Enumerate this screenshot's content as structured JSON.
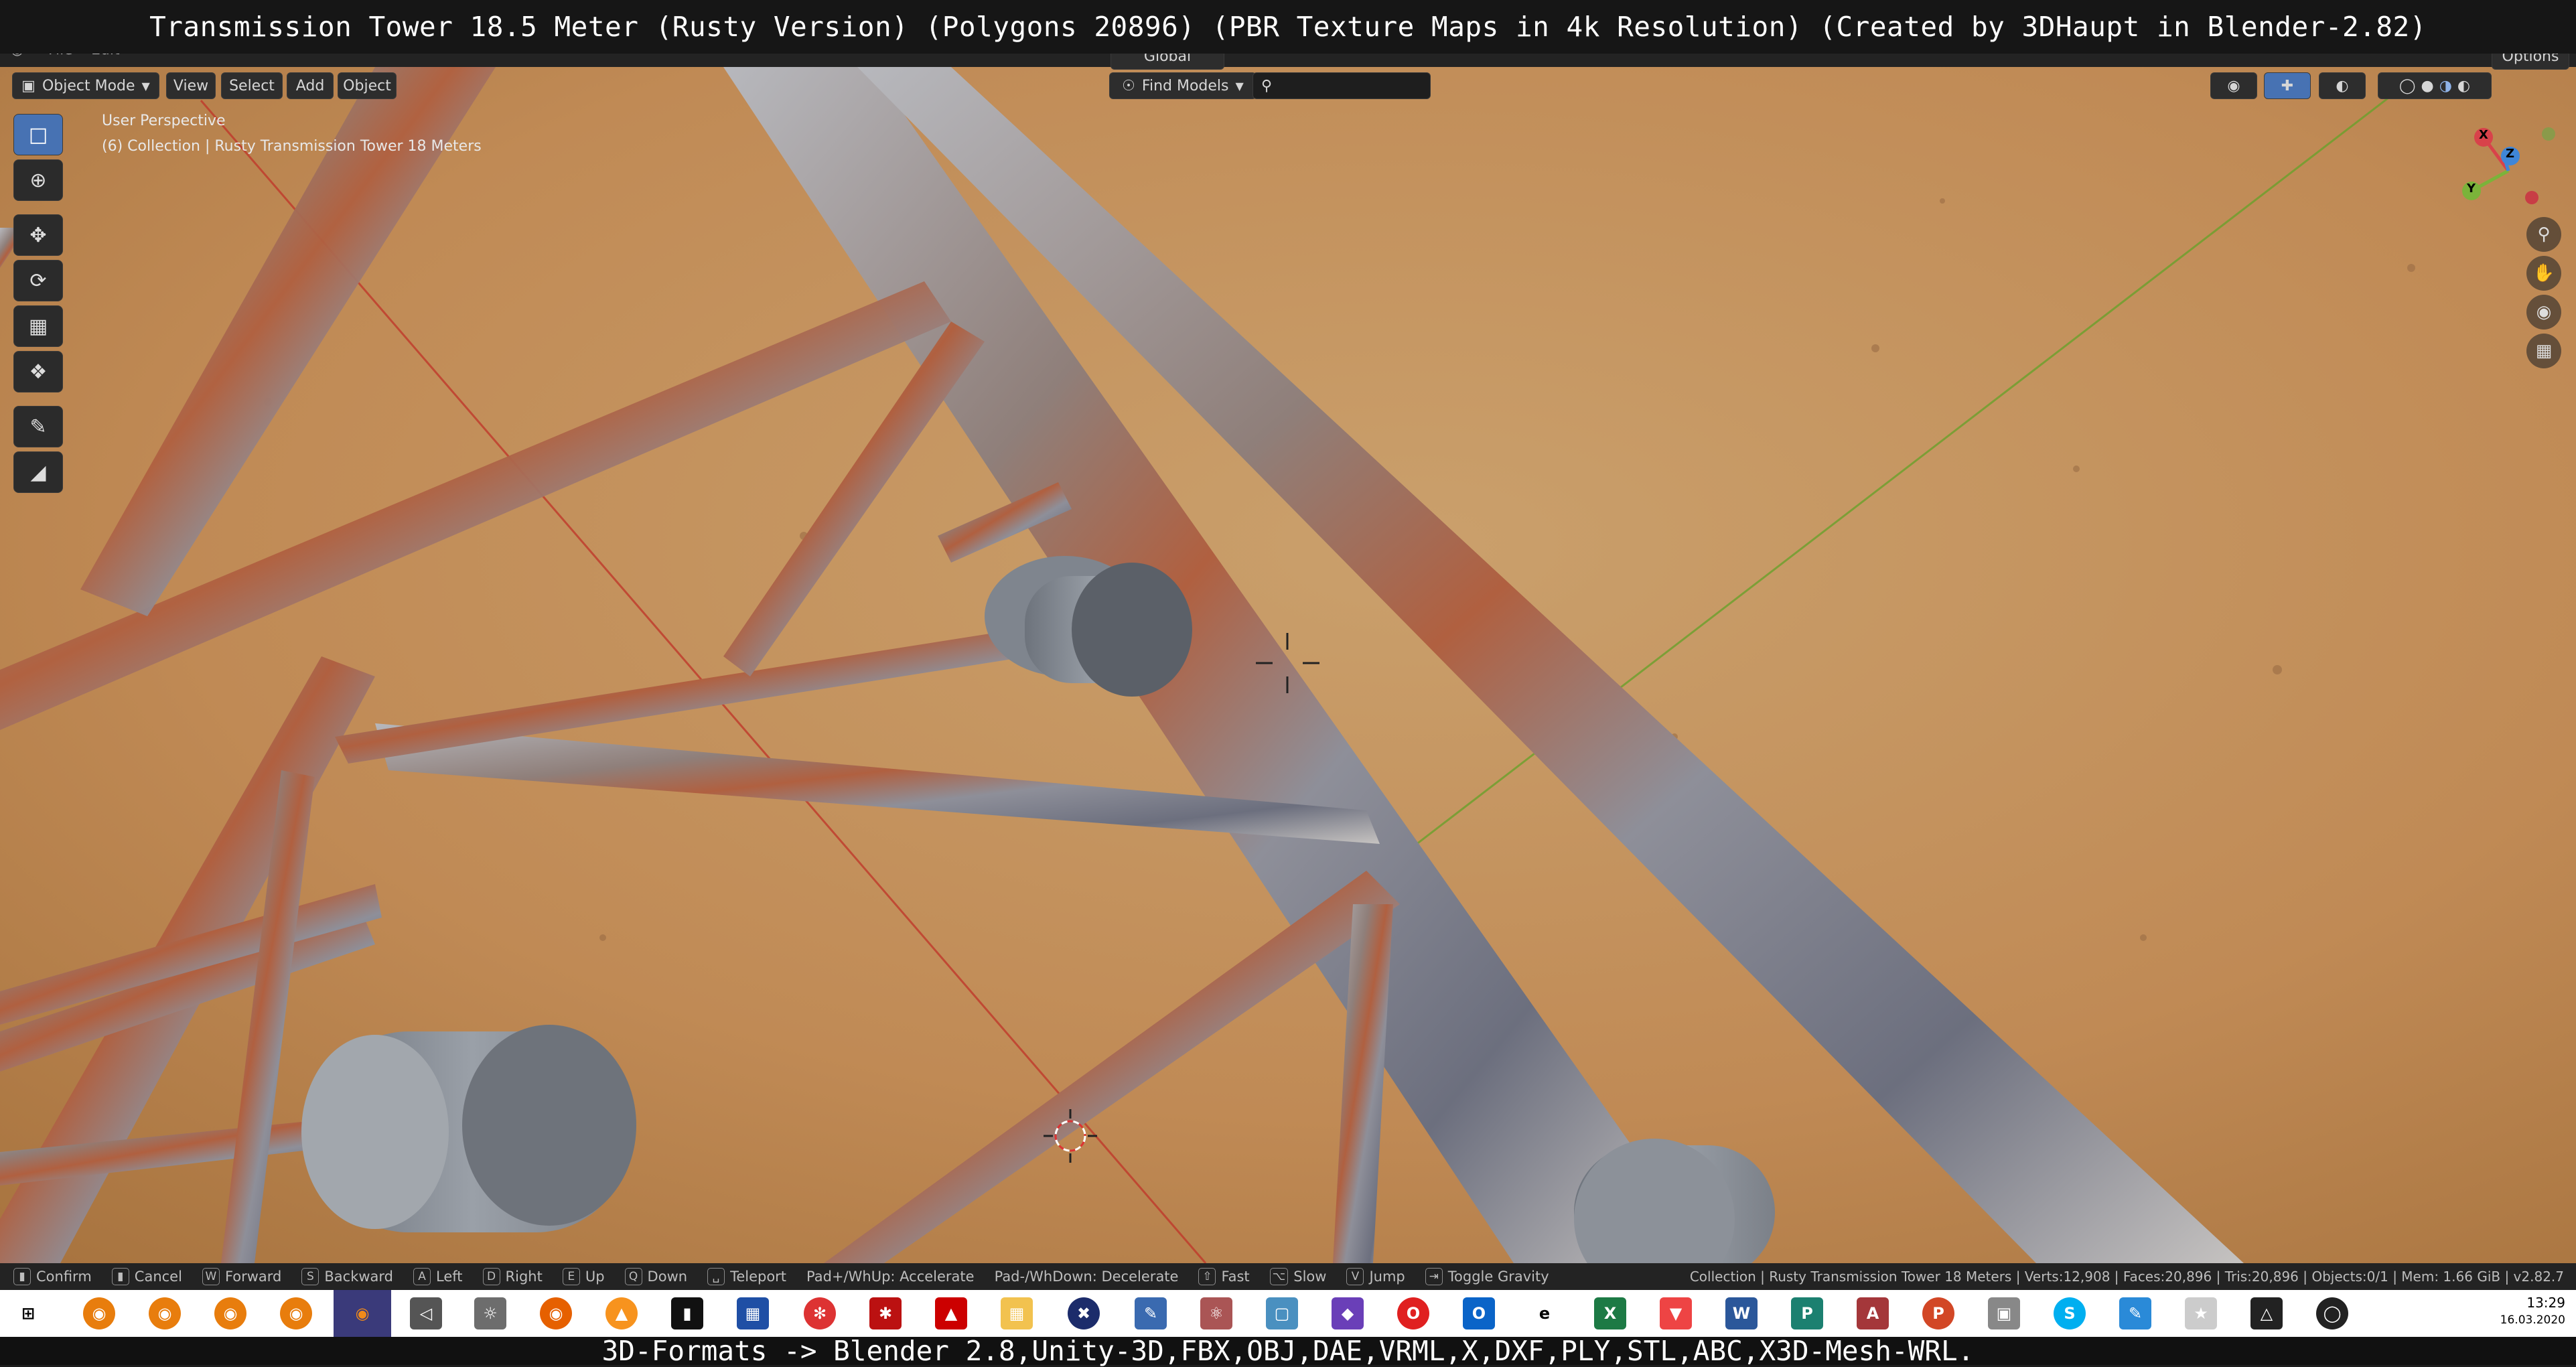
{
  "title_overlay": "Transmission Tower 18.5 Meter (Rusty Version) (Polygons 20896) (PBR Texture Maps in 4k Resolution) (Created by 3DHaupt in Blender-2.82)",
  "formats_overlay": "3D-Formats -> Blender 2.8,Unity-3D,FBX,OBJ,DAE,VRML,X,DXF,PLY,STL,ABC,X3D-Mesh-WRL.",
  "menu": {
    "file": "File",
    "edit": "Edit"
  },
  "header": {
    "mode": "Object Mode",
    "view": "View",
    "select": "Select",
    "add": "Add",
    "object": "Object",
    "transform": "Global",
    "find_models": "Find Models",
    "options": "Options"
  },
  "viewport": {
    "perspective": "User Perspective",
    "collection": "(6) Collection | Rusty Transmission Tower 18 Meters"
  },
  "gizmo": {
    "x": "X",
    "y": "Y",
    "z": "Z"
  },
  "status": {
    "confirm_key": "",
    "confirm": "Confirm",
    "cancel": "Cancel",
    "forward_key": "W",
    "forward": "Forward",
    "backward_key": "S",
    "backward": "Backward",
    "left_key": "A",
    "left": "Left",
    "right_key": "D",
    "right": "Right",
    "up_key": "E",
    "up": "Up",
    "down_key": "Q",
    "down": "Down",
    "teleport": "Teleport",
    "accelerate": "Pad+/WhUp: Accelerate",
    "decelerate": "Pad-/WhDown: Decelerate",
    "fast": "Fast",
    "slow": "Slow",
    "jump_key": "V",
    "jump": "Jump",
    "gravity": "Toggle Gravity",
    "stats": "Collection | Rusty Transmission Tower 18 Meters | Verts:12,908 | Faces:20,896 | Tris:20,896 | Objects:0/1 | Mem: 1.66 GiB | v2.82.7"
  },
  "clock": {
    "time": "13:29",
    "date": "16.03.2020"
  },
  "colors": {
    "ground": "#c08a55",
    "steel": "#8e8f93",
    "rust": "#b0593a",
    "insulator": "#8f949b",
    "accent": "#4772b3"
  }
}
